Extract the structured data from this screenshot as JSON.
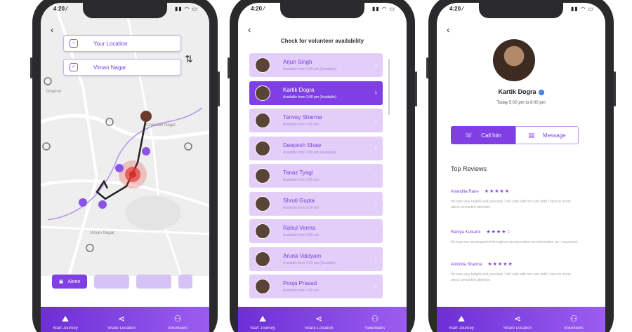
{
  "status": {
    "time": "4:20 ⁄",
    "icons": "▮▮ ◠ ▭"
  },
  "map_screen": {
    "your_location": "Your Location",
    "destination": "Viman Nagar",
    "map_labels": [
      "Dhanori",
      "Viman Nagar",
      "Chandan Nagar"
    ],
    "chips": [
      "Alone",
      "",
      "",
      ""
    ],
    "tabs": [
      {
        "label": "Start Journey",
        "icon": "person-walk-icon"
      },
      {
        "label": "Share Location",
        "icon": "share-icon"
      },
      {
        "label": "Volunteers",
        "icon": "group-icon"
      }
    ]
  },
  "list_screen": {
    "title": "Check for volunteer availability",
    "volunteers": [
      {
        "name": "Arjun Singh",
        "sub": "Available from 2:00 pm (Available)"
      },
      {
        "name": "Kartik Dogra",
        "sub": "Available from 2:00 pm (Available)"
      },
      {
        "name": "Tanvey Sharma",
        "sub": "Available from 2:00 pm"
      },
      {
        "name": "Deepesh Shaw",
        "sub": "Available from 2:00 pm (Available)"
      },
      {
        "name": "Tanaz Tyagi",
        "sub": "Available from 2:00 pm"
      },
      {
        "name": "Shruti Gupta",
        "sub": "Available from 2:00 pm"
      },
      {
        "name": "Rahul Verma",
        "sub": "Available from 2:00 pm"
      },
      {
        "name": "Aruna Vaidyam",
        "sub": "Available from 2:00 pm (Available)"
      },
      {
        "name": "Pooja Prasad",
        "sub": "Available from 2:00 pm"
      }
    ],
    "selected_index": 1,
    "tabs": [
      {
        "label": "Start Journey",
        "icon": "person-walk-icon"
      },
      {
        "label": "Share Location",
        "icon": "share-icon"
      },
      {
        "label": "Volunteers",
        "icon": "group-icon"
      }
    ]
  },
  "profile_screen": {
    "name": "Kartik Dogra",
    "time": "Today 5:00 pm to 8:00 pm",
    "call_label": "Call him",
    "message_label": "Message",
    "reviews_title": "Top Reviews",
    "reviews": [
      {
        "name": "Anandita Rane",
        "stars": "★★★★★",
        "text": "He was very helpful and punctual. I felt safe with him and didn't have to worry about unwanted attention."
      },
      {
        "name": "Ramya Kulkarni",
        "stars": "★★★★☆",
        "text": "He kept me accompanied throughout and provided me information as I requested."
      },
      {
        "name": "Anindita Sharma",
        "stars": "★★★★★",
        "text": "He was very helpful and punctual. I felt safe with him and didn't have to worry about unwanted attention."
      }
    ],
    "tabs": [
      {
        "label": "Start Journey",
        "icon": "person-walk-icon"
      },
      {
        "label": "Share Location",
        "icon": "share-icon"
      },
      {
        "label": "Volunteers",
        "icon": "group-icon"
      }
    ]
  },
  "colors": {
    "primary": "#7f3fe4",
    "light": "#e2cef9",
    "accent_red": "#e53935"
  }
}
